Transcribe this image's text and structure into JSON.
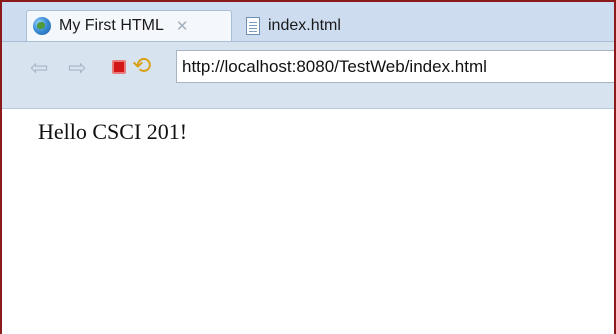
{
  "tabs": [
    {
      "label": "My First HTML",
      "icon": "globe-icon",
      "close_glyph": "✕",
      "active": true
    },
    {
      "label": "index.html",
      "icon": "html-file-icon",
      "active": false
    }
  ],
  "toolbar": {
    "back_glyph": "⇦",
    "forward_glyph": "⇨",
    "refresh_glyph": "⟲"
  },
  "address": {
    "value": "http://localhost:8080/TestWeb/index.html"
  },
  "content": {
    "text": "Hello CSCI 201!"
  },
  "colors": {
    "frame_border": "#8b1a1a",
    "tabbar_bg": "#cdddef",
    "toolbar_bg": "#d8e3f0",
    "stop_red": "#d01818",
    "refresh_orange": "#d89f12"
  }
}
